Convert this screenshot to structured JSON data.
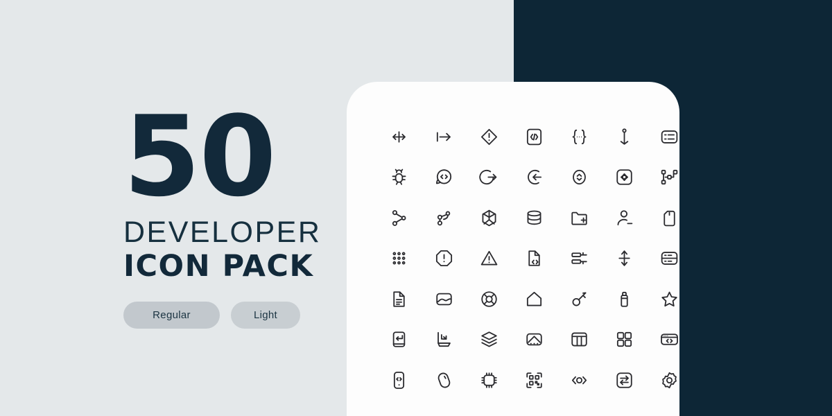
{
  "hero": {
    "number": "50",
    "line1": "DEVELOPER",
    "line2": "ICON PACK",
    "weight_regular": "Regular",
    "weight_light": "Light"
  },
  "colors": {
    "background": "#e4e8ea",
    "dark_panel": "#0d2636",
    "card": "#fdfdfd",
    "text_dark": "#12293a",
    "icon_stroke": "#2b2b2f",
    "pill_regular": "#c2c8cd",
    "pill_light": "#c8ced2"
  },
  "icon_grid": {
    "columns": 7,
    "rows": 7,
    "count": 49,
    "icons": [
      "arrows-horizontal-icon",
      "arrow-to-line-icon",
      "alert-diamond-icon",
      "code-square-icon",
      "curly-braces-icon",
      "anchor-icon",
      "list-panel-icon",
      "bug-icon",
      "code-chat-bubble-icon",
      "logout-icon",
      "login-icon",
      "sort-circle-icon",
      "fullscreen-frame-icon",
      "sitemap-icon",
      "git-merge-icon",
      "git-branch-icon",
      "cube-icon",
      "database-icon",
      "folder-add-icon",
      "user-remove-icon",
      "sd-card-icon",
      "dots-grid-icon",
      "octagon-alert-icon",
      "warning-triangle-icon",
      "file-code-icon",
      "filter-bars-icon",
      "arrows-vertical-icon",
      "server-icon",
      "document-icon",
      "image-icon",
      "lifebuoy-icon",
      "home-icon",
      "key-icon",
      "usb-drive-icon",
      "star-icon",
      "enter-key-icon",
      "import-download-icon",
      "layers-icon",
      "upload-panel-icon",
      "columns-layout-icon",
      "grid-four-icon",
      "code-window-icon",
      "mobile-code-icon",
      "mouse-icon",
      "cpu-chip-icon",
      "qr-code-icon",
      "code-circle-icon",
      "swap-arrows-icon",
      "settings-gear-icon"
    ]
  }
}
